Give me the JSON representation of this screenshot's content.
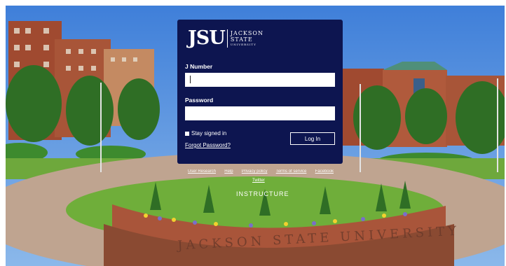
{
  "logo": {
    "mark": "JSU",
    "line1": "JACKSON",
    "line2": "STATE",
    "line3": "UNIVERSITY"
  },
  "form": {
    "jnumber_label": "J Number",
    "jnumber_value": "",
    "password_label": "Password",
    "password_value": "",
    "stay_signed_in": "Stay signed in",
    "stay_signed_in_checked": false,
    "forgot_password": "Forgot Password?",
    "login_button": "Log In"
  },
  "footer": {
    "links": [
      "User Research",
      "Help",
      "Privacy policy",
      "Terms of service",
      "Facebook"
    ],
    "twitter": "Twitter",
    "brand": "INSTRUCTURE"
  },
  "background": {
    "wall_text": "JACKSON STATE UNIVERSITY",
    "panel_color": "#0d1550"
  }
}
